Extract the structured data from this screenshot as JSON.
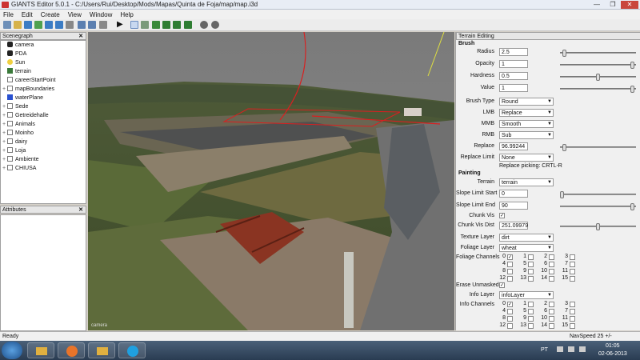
{
  "window": {
    "title": "GIANTS Editor 5.0.1 - C:/Users/Rui/Desktop/Mods/Mapas/Quinta de Foja/map/map.i3d"
  },
  "menu": [
    "File",
    "Edit",
    "Create",
    "View",
    "Window",
    "Help"
  ],
  "scenegraph": {
    "header": "Scenegraph",
    "items": [
      {
        "label": "camera",
        "icon": "camera-icon",
        "expand": false
      },
      {
        "label": "PDA",
        "icon": "camera-icon",
        "expand": false
      },
      {
        "label": "Sun",
        "icon": "light-icon",
        "expand": false
      },
      {
        "label": "terrain",
        "icon": "terrain-icon",
        "expand": false
      },
      {
        "label": "careerStartPoint",
        "icon": "transform-icon",
        "expand": false
      },
      {
        "label": "mapBoundaries",
        "icon": "transform-icon",
        "expand": true
      },
      {
        "label": "waterPlane",
        "icon": "mesh-icon",
        "expand": false
      },
      {
        "label": "Sede",
        "icon": "transform-icon",
        "expand": true
      },
      {
        "label": "Getreidehalle",
        "icon": "transform-icon",
        "expand": true
      },
      {
        "label": "Animals",
        "icon": "transform-icon",
        "expand": true
      },
      {
        "label": "Moinho",
        "icon": "transform-icon",
        "expand": true
      },
      {
        "label": "dairy",
        "icon": "transform-icon",
        "expand": true
      },
      {
        "label": "Loja",
        "icon": "transform-icon",
        "expand": true
      },
      {
        "label": "Ambiente",
        "icon": "transform-icon",
        "expand": true
      },
      {
        "label": "CHIUSA",
        "icon": "transform-icon",
        "expand": true
      }
    ]
  },
  "attributes": {
    "header": "Attributes"
  },
  "viewport": {
    "camera_label": "camera"
  },
  "terrain": {
    "header": "Terrain Editing",
    "brush_title": "Brush",
    "radius": {
      "label": "Radius",
      "value": "2.5",
      "level": 0.05
    },
    "opacity": {
      "label": "Opacity",
      "value": "1",
      "level": 1.0
    },
    "hardness": {
      "label": "Hardness",
      "value": "0.5",
      "level": 0.5
    },
    "value": {
      "label": "Value",
      "value": "1",
      "level": 1.0
    },
    "brush_type": {
      "label": "Brush Type",
      "value": "Round"
    },
    "lmb": {
      "label": "LMB",
      "value": "Replace"
    },
    "mmb": {
      "label": "MMB",
      "value": "Smooth"
    },
    "rmb": {
      "label": "RMB",
      "value": "Sub"
    },
    "replace": {
      "label": "Replace",
      "value": "96.99244",
      "level": 0.05
    },
    "replace_limit": {
      "label": "Replace Limit",
      "value": "None"
    },
    "replace_picking": "Replace picking: CRTL-R",
    "painting_title": "Painting",
    "paint_terrain": {
      "label": "Terrain",
      "value": "terrain"
    },
    "slope_start": {
      "label": "Slope Limit Start",
      "value": "0",
      "level": 0.0
    },
    "slope_end": {
      "label": "Slope Limit End",
      "value": "90",
      "level": 1.0
    },
    "chunk_vis": {
      "label": "Chunk Vis",
      "checked": true
    },
    "chunk_vis_dist": {
      "label": "Chunk Vis Dist",
      "value": "251.09979",
      "level": 0.5
    },
    "texture_layer": {
      "label": "Texture Layer",
      "value": "dirt"
    },
    "foliage_layer": {
      "label": "Foliage Layer",
      "value": "wheat"
    },
    "foliage_channels": {
      "label": "Foliage Channels",
      "channels": [
        "0",
        "1",
        "2",
        "3",
        "4",
        "5",
        "6",
        "7",
        "8",
        "9",
        "10",
        "11",
        "12",
        "13",
        "14",
        "15"
      ],
      "checked": [
        "0"
      ]
    },
    "erase_unmasked": {
      "label": "Erase Unmasked",
      "checked": true
    },
    "info_layer": {
      "label": "Info Layer",
      "value": "infoLayer"
    },
    "info_channels": {
      "label": "Info Channels",
      "channels": [
        "0",
        "1",
        "2",
        "3",
        "4",
        "5",
        "6",
        "7",
        "8",
        "9",
        "10",
        "11",
        "12",
        "13",
        "14",
        "15"
      ],
      "checked": [
        "0"
      ]
    }
  },
  "status": {
    "left": "Ready",
    "right": "NavSpeed 25 +/-"
  },
  "taskbar": {
    "lang": "PT",
    "time": "01:05",
    "date": "02-06-2013"
  }
}
